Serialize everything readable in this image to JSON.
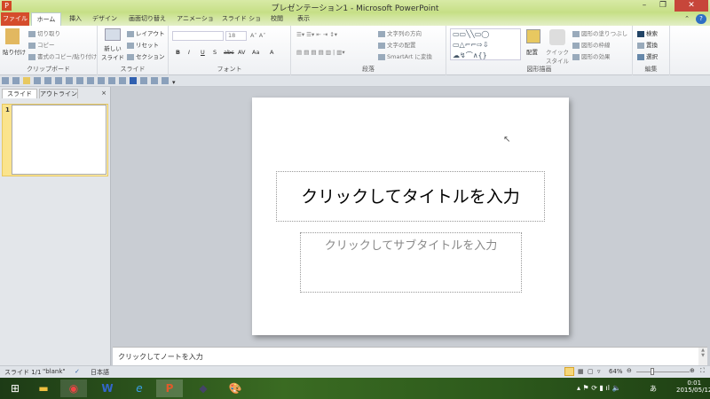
{
  "window": {
    "title": "プレゼンテーション1 - Microsoft PowerPoint",
    "app_icon": "P",
    "minimize": "–",
    "restore": "❐",
    "close": "✕"
  },
  "tabs": [
    "ファイル",
    "ホーム",
    "挿入",
    "デザイン",
    "画面切り替え",
    "アニメーション",
    "スライド ショー",
    "校閲",
    "表示"
  ],
  "ribbon": {
    "clipboard": {
      "label": "クリップボード",
      "paste": "貼り付け",
      "cut": "切り取り",
      "copy": "コピー",
      "format_painter": "書式のコピー/貼り付け"
    },
    "slides": {
      "label": "スライド",
      "new_slide": "新しい\nスライド",
      "layout": "レイアウト",
      "reset": "リセット",
      "section": "セクション"
    },
    "font": {
      "label": "フォント",
      "size": "18",
      "buttons": [
        "B",
        "I",
        "U",
        "S",
        "abc",
        "AV",
        "Aa",
        "A"
      ]
    },
    "paragraph": {
      "label": "段落",
      "text_direction": "文字列の方向",
      "align_text": "文字の配置",
      "smartart": "SmartArt に変換"
    },
    "drawing": {
      "label": "図形描画",
      "arrange": "配置",
      "quick_styles": "クイック\nスタイル",
      "shape_fill": "図形の塗りつぶし",
      "shape_outline": "図形の枠線",
      "shape_effects": "図形の効果"
    },
    "editing": {
      "label": "編集",
      "find": "検索",
      "replace": "置換",
      "select": "選択"
    }
  },
  "left_pane": {
    "tabs": [
      "スライド",
      "アウトライン"
    ],
    "close": "×",
    "slide_number": "1"
  },
  "slide": {
    "title_placeholder": "クリックしてタイトルを入力",
    "subtitle_placeholder": "クリックしてサブタイトルを入力"
  },
  "notes": {
    "placeholder": "クリックしてノートを入力"
  },
  "status": {
    "slide": "スライド 1/1",
    "theme": "\"blank\"",
    "language": "日本語",
    "zoom": "64%",
    "zoom_value": 64
  },
  "taskbar": {
    "time": "0:01",
    "date": "2015/05/12",
    "ime": "あ"
  }
}
